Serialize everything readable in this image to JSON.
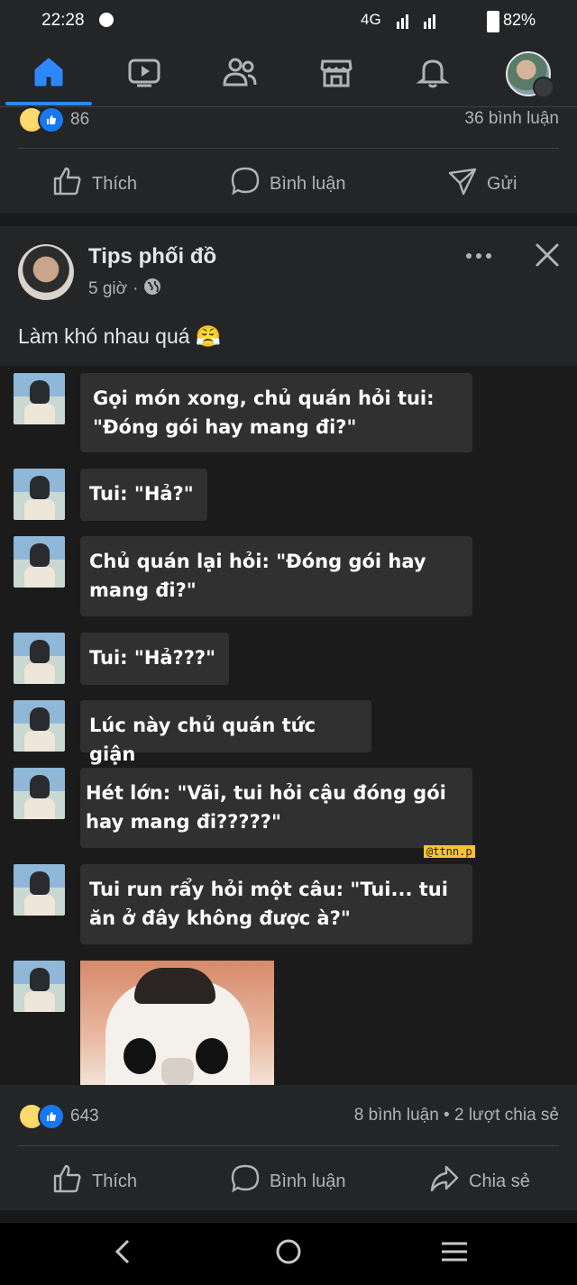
{
  "status_bar": {
    "time": "22:28",
    "network": "4G",
    "battery": "82%"
  },
  "tabs": [
    {
      "name": "home",
      "icon": "home-icon",
      "active": true
    },
    {
      "name": "watch",
      "icon": "video-icon"
    },
    {
      "name": "friends",
      "icon": "friends-icon"
    },
    {
      "name": "marketplace",
      "icon": "marketplace-icon"
    },
    {
      "name": "notifications",
      "icon": "bell-icon"
    },
    {
      "name": "profile",
      "icon": "profile-avatar"
    }
  ],
  "prev_post": {
    "reactions": "86",
    "comments": "36 bình luận"
  },
  "actions": {
    "like": "Thích",
    "comment": "Bình luận",
    "send": "Gửi",
    "share": "Chia sẻ"
  },
  "post": {
    "page_name": "Tips phối đồ",
    "time": "5 giờ",
    "dot": "·",
    "caption": "Làm khó nhau quá 😤",
    "reactions": "643",
    "stats": "8 bình luận • 2 lượt chia sẻ"
  },
  "image": {
    "bubbles": [
      "Gọi món xong, chủ quán hỏi tui: \"Đóng gói hay mang đi?\"",
      "Tui: \"Hả?\"",
      "Chủ quán lại hỏi: \"Đóng gói hay mang đi?\"",
      "Tui: \"Hả???\"",
      "Lúc này chủ quán tức giận",
      "Hét lớn: \"Vãi, tui hỏi cậu đóng gói hay mang đi?????\"",
      "Tui run rẩy hỏi một câu: \"Tui... tui ăn ở đây không được à?\""
    ],
    "watermark": "@ttnn.p"
  },
  "colors": {
    "accent": "#2d88ff",
    "background": "#242526",
    "separator": "#18191a"
  }
}
